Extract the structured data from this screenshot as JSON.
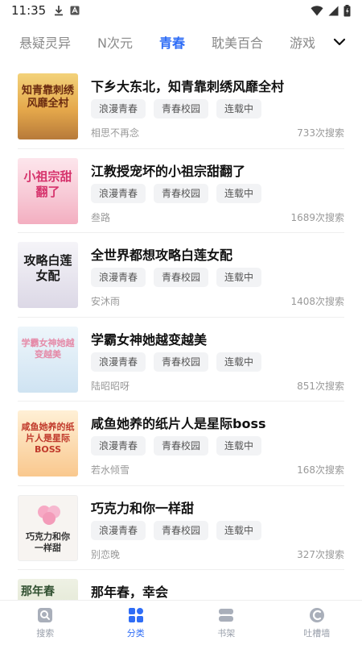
{
  "status_bar": {
    "time": "11:35"
  },
  "tabs": [
    {
      "label": "悬疑灵异",
      "active": false
    },
    {
      "label": "N次元",
      "active": false
    },
    {
      "label": "青春",
      "active": true
    },
    {
      "label": "耽美百合",
      "active": false
    },
    {
      "label": "游戏",
      "active": false
    }
  ],
  "books": [
    {
      "title": "下乡大东北，知青靠刺绣风靡全村",
      "tags": [
        "浪漫青春",
        "青春校园",
        "连载中"
      ],
      "author": "相思不再念",
      "count": "733次搜索",
      "cover_text": "知青靠刺绣风靡全村",
      "cover_color": "#e9b45a"
    },
    {
      "title": "江教授宠坏的小祖宗甜翻了",
      "tags": [
        "浪漫青春",
        "青春校园",
        "连载中"
      ],
      "author": "叁路",
      "count": "1689次搜索",
      "cover_text": "小祖宗甜翻了",
      "cover_color": "#f7d6df"
    },
    {
      "title": "全世界都想攻略白莲女配",
      "tags": [
        "浪漫青春",
        "青春校园",
        "连载中"
      ],
      "author": "安沐雨",
      "count": "1408次搜索",
      "cover_text": "攻略白莲女配",
      "cover_color": "#e8e6ee"
    },
    {
      "title": "学霸女神她越变越美",
      "tags": [
        "浪漫青春",
        "青春校园",
        "连载中"
      ],
      "author": "陆昭昭呀",
      "count": "851次搜索",
      "cover_text": "学霸女神她越变越美",
      "cover_color": "#dcebf7"
    },
    {
      "title": "咸鱼她养的纸片人是星际boss",
      "tags": [
        "浪漫青春",
        "青春校园",
        "连载中"
      ],
      "author": "若水倾雪",
      "count": "168次搜索",
      "cover_text": "咸鱼她养的纸片人是星际BOSS",
      "cover_color": "#fbd3a8"
    },
    {
      "title": "巧克力和你一样甜",
      "tags": [
        "浪漫青春",
        "青春校园",
        "连载中"
      ],
      "author": "别恋晚",
      "count": "327次搜索",
      "cover_text": "巧克力和你一样甜",
      "cover_color": "#f6f2ef"
    },
    {
      "title": "那年春，幸会",
      "tags": [],
      "author": "",
      "count": "",
      "cover_text": "那年春",
      "cover_color": "#e6ead8"
    }
  ],
  "bottom_nav": [
    {
      "label": "搜索",
      "icon": "search-icon",
      "active": false
    },
    {
      "label": "分类",
      "icon": "category-icon",
      "active": true
    },
    {
      "label": "书架",
      "icon": "bookshelf-icon",
      "active": false
    },
    {
      "label": "吐槽墙",
      "icon": "comment-wall-icon",
      "active": false
    }
  ],
  "colors": {
    "accent": "#2f6df6",
    "muted": "#999999"
  }
}
